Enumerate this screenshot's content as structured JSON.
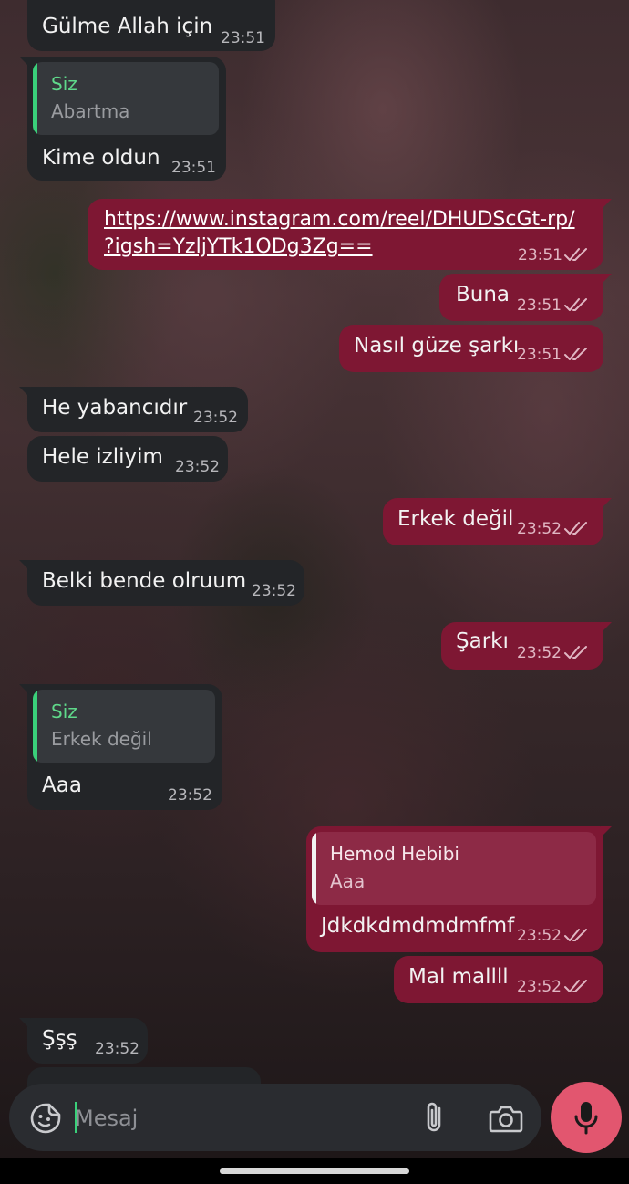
{
  "theme": {
    "incoming_bubble": "#232528",
    "outgoing_bubble": "#7e1733",
    "reply_accent": "#3ad07a",
    "mic_button": "#e2566f"
  },
  "messages": [
    {
      "direction": "in",
      "text": "Gülme Allah için",
      "time": "23:51"
    },
    {
      "direction": "in",
      "reply_to": {
        "author": "Siz",
        "text": "Abartma"
      },
      "text": "Kime oldun",
      "time": "23:51"
    },
    {
      "direction": "out",
      "link_lines": [
        "https://www.instagram.com/reel/DHUDScGt-rp/",
        "?igsh=YzljYTk1ODg3Zg=="
      ],
      "time": "23:51",
      "status": "read-double-check-icon"
    },
    {
      "direction": "out",
      "text": "Buna",
      "time": "23:51",
      "status": "read-double-check-icon"
    },
    {
      "direction": "out",
      "text": "Nasıl güze şarkı",
      "time": "23:51",
      "status": "read-double-check-icon"
    },
    {
      "direction": "in",
      "text": "He yabancıdır",
      "time": "23:52"
    },
    {
      "direction": "in",
      "text": "Hele izliyim",
      "time": "23:52"
    },
    {
      "direction": "out",
      "text": "Erkek değil",
      "time": "23:52",
      "status": "read-double-check-icon"
    },
    {
      "direction": "in",
      "text": "Belki bende olruum",
      "time": "23:52"
    },
    {
      "direction": "out",
      "text": "Şarkı",
      "time": "23:52",
      "status": "read-double-check-icon"
    },
    {
      "direction": "in",
      "reply_to": {
        "author": "Siz",
        "text": "Erkek değil"
      },
      "text": "Aaa",
      "time": "23:52"
    },
    {
      "direction": "out",
      "reply_to": {
        "author": "Hemod Hebibi",
        "text": "Aaa"
      },
      "text": "Jdkdkdmdmdmfmf",
      "time": "23:52",
      "status": "read-double-check-icon"
    },
    {
      "direction": "out",
      "text": "Mal mallll",
      "time": "23:52",
      "status": "read-double-check-icon"
    },
    {
      "direction": "in",
      "text": "Şşş",
      "time": "23:52"
    }
  ],
  "composer": {
    "placeholder": "Mesaj",
    "value": "",
    "icons": [
      "sticker-emoji-icon",
      "attach-paperclip-icon",
      "camera-icon"
    ],
    "send_icon": "microphone-icon"
  }
}
